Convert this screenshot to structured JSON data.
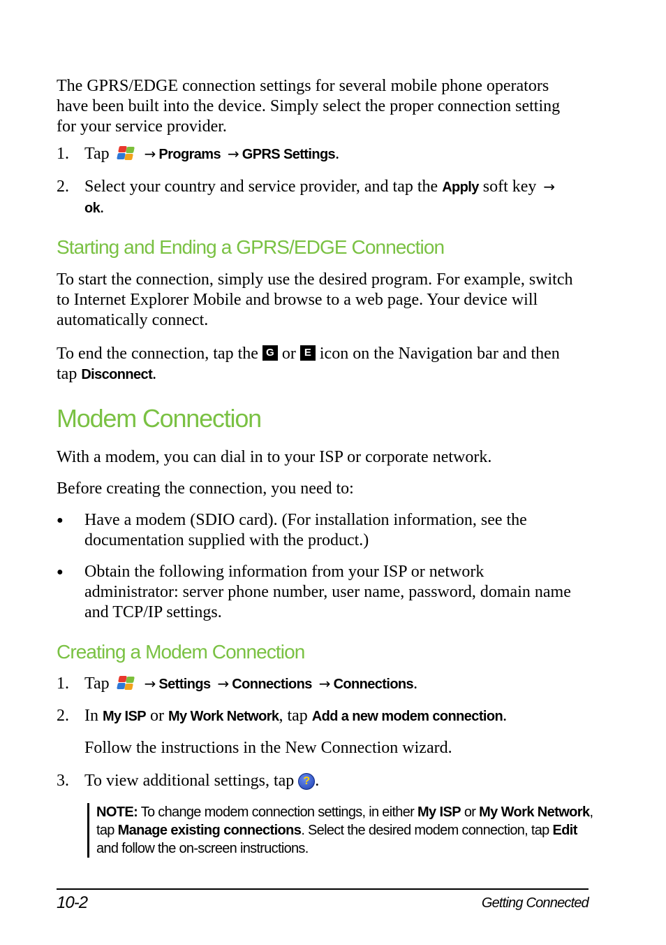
{
  "intro": {
    "paragraph": [
      "The GPRS/EDGE connection settings for several mobile phone operators",
      "have been built into the device. Simply select the proper connection setting",
      "for your service provider."
    ]
  },
  "gprs_steps": [
    {
      "number": "1.",
      "prefix": "Tap",
      "icon": "windows-start-icon",
      "path": [
        "Programs",
        "GPRS Settings"
      ],
      "suffix": "."
    },
    {
      "number": "2.",
      "text_before": "Select your country and service provider, and tap the",
      "bold": "Apply",
      "text_after": "soft key",
      "bold2": "ok",
      "suffix": "."
    }
  ],
  "section_start_end": {
    "heading": "Starting and Ending a GPRS/EDGE Connection",
    "paragraph1": [
      "To start the connection, simply use the desired program. For example, switch",
      "to Internet Explorer Mobile and browse to a web page. Your device will",
      "automatically connect."
    ],
    "paragraph2": {
      "before": "To end the connection, tap the",
      "icon_g": "G",
      "or": "or",
      "icon_e": "E",
      "after": "icon on the Navigation bar and then",
      "line2_prefix": "tap",
      "bold": "Disconnect",
      "suffix": "."
    }
  },
  "modem": {
    "heading": "Modem Connection",
    "paragraph1": "With a modem, you can dial in to your ISP or corporate network.",
    "paragraph2": "Before creating the connection, you need to:",
    "bullets": [
      {
        "symbol": "●",
        "lines": [
          "Have a modem (SDIO card). (For installation information, see the",
          "documentation supplied with the product.)"
        ]
      },
      {
        "symbol": "●",
        "lines": [
          "Obtain the following information from your ISP or network",
          "administrator: server phone number, user name, password, domain name",
          "and TCP/IP settings."
        ]
      }
    ]
  },
  "creating": {
    "heading": "Creating a Modem Connection",
    "steps": [
      {
        "number": "1.",
        "prefix": "Tap",
        "path": [
          "Settings",
          "Connections",
          "Connections"
        ],
        "suffix": "."
      },
      {
        "number": "2.",
        "in": "In",
        "b1": "My ISP",
        "or": "or",
        "b2": "My Work Network",
        "tap": ", tap",
        "b3": "Add a new modem connection",
        "suffix": ".",
        "followup": "Follow the instructions in the New Connection wizard."
      },
      {
        "number": "3.",
        "text": "To view additional settings, tap",
        "icon": "help-icon",
        "suffix": "."
      }
    ],
    "note": {
      "label": "NOTE:",
      "t1": "To change modem connection settings, in either",
      "b1": "My ISP",
      "t2": "or",
      "b2": "My Work Network",
      "t3": ",",
      "t4": "tap",
      "b3": "Manage existing connections",
      "t5": ". Select the desired modem connection, tap",
      "b4": "Edit",
      "t6": "and follow the on-screen instructions."
    }
  },
  "footer": {
    "page_number": "10-2",
    "chapter": "Getting Connected"
  },
  "symbols": {
    "arrow": "→",
    "help": "?"
  },
  "colors": {
    "heading_green": "#7ac143"
  }
}
